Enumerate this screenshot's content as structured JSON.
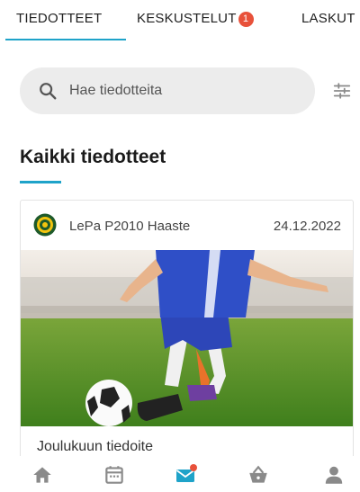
{
  "tabs": [
    {
      "label": "TIEDOTTEET",
      "active": true
    },
    {
      "label": "KESKUSTELUT",
      "badge": "1"
    },
    {
      "label": "LASKUT"
    }
  ],
  "search": {
    "placeholder": "Hae tiedotteita",
    "icon": "search-icon"
  },
  "filter": {
    "icon": "filter-icon"
  },
  "section": {
    "title": "Kaikki tiedotteet"
  },
  "card": {
    "club_name": "LePa P2010 Haaste",
    "date": "24.12.2022",
    "title": "Joulukuun tiedoite"
  },
  "bottom_nav": [
    {
      "icon": "home-icon"
    },
    {
      "icon": "calendar-icon"
    },
    {
      "icon": "mail-icon",
      "active": true,
      "notification": true
    },
    {
      "icon": "basket-icon"
    },
    {
      "icon": "user-icon"
    }
  ],
  "colors": {
    "accent": "#1fa3c9",
    "badge": "#e8513a",
    "icon": "#8a8a8a"
  }
}
